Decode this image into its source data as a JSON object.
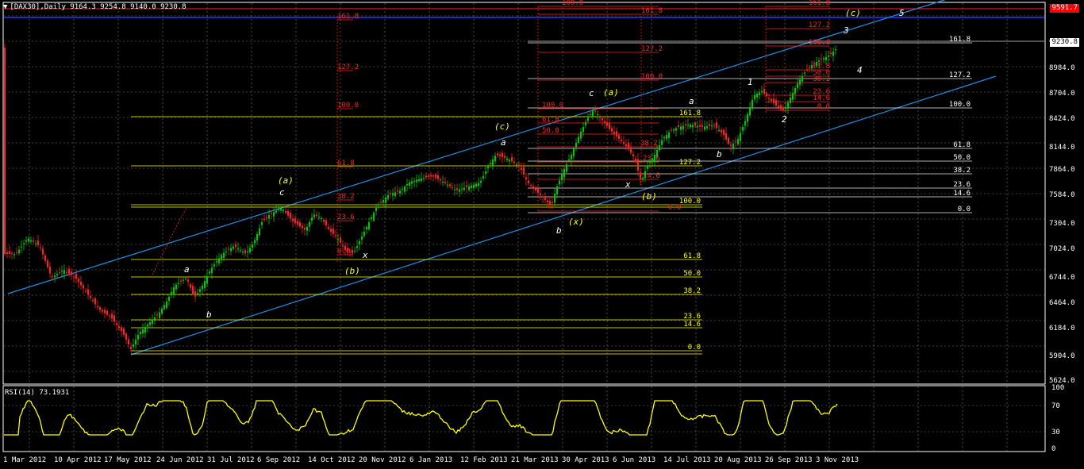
{
  "window": {
    "title": "[DAX30],Daily  9164.3 9254.8 9140.0 9230.8",
    "rsi_title": "RSI(14) 73.1931"
  },
  "price_axis": {
    "labels": [
      "9264.0",
      "8984.0",
      "8704.0",
      "8424.0",
      "8144.0",
      "7864.0",
      "7584.0",
      "7304.0",
      "7024.0",
      "6744.0",
      "6464.0",
      "6184.0",
      "5904.0",
      "5624.0"
    ],
    "current_price": "9230.8",
    "marker_price": "9591.7"
  },
  "rsi_axis": {
    "labels": [
      "100",
      "70",
      "30",
      "0"
    ]
  },
  "date_axis": {
    "labels": [
      "1 Mar 2012",
      "10 Apr 2012",
      "17 May 2012",
      "24 Jun 2012",
      "31 Jul 2012",
      "6 Sep 2012",
      "14 Oct 2012",
      "20 Nov 2012",
      "6 Jan 2013",
      "12 Feb 2013",
      "21 Mar 2013",
      "30 Apr 2013",
      "6 Jun 2013",
      "14 Jul 2013",
      "20 Aug 2013",
      "26 Sep 2013",
      "3 Nov 2013"
    ]
  },
  "fib_yellow_1": [
    "61.8",
    "50.0",
    "38.2",
    "23.6",
    "14.6",
    "0.0"
  ],
  "fib_yellow_2": [
    "161.8",
    "127.2",
    "100.0"
  ],
  "fib_white": [
    "161.8",
    "127.2",
    "100.0",
    "61.8",
    "50.0",
    "38.2",
    "23.6",
    "14.6",
    "0.0"
  ],
  "fib_red_a": [
    "161.8",
    "127.2",
    "100.0",
    "61.8",
    "38.2",
    "23.6",
    "0.0"
  ],
  "fib_red_b": [
    "100.0",
    "161.8",
    "127.2",
    "100.0",
    "61.8",
    "50.0",
    "38.2",
    "23.6",
    "14.6",
    "0.0"
  ],
  "fib_red_c": [
    "161.8",
    "127.2",
    "100.0",
    "61.8",
    "50.0",
    "38.2",
    "23.6",
    "14.6",
    "0.0"
  ],
  "wave_labels": [
    "(a)",
    "c",
    "a",
    "b",
    "(b)",
    "x",
    "(c)",
    "a",
    "b",
    "(x)",
    "c",
    "(a)",
    "x",
    "(b)",
    "a",
    "b",
    "1",
    "2",
    "3",
    "4",
    "5",
    "(c)"
  ],
  "colors": {
    "background": "#000000",
    "grid": "#7a7a7a",
    "bull_candle": "#00c800",
    "bear_candle": "#ff2020",
    "channel": "#1e8fe0",
    "fib_yellow": "#ffff00",
    "fib_red": "#ff2020",
    "rsi_line": "#ffff00"
  }
}
